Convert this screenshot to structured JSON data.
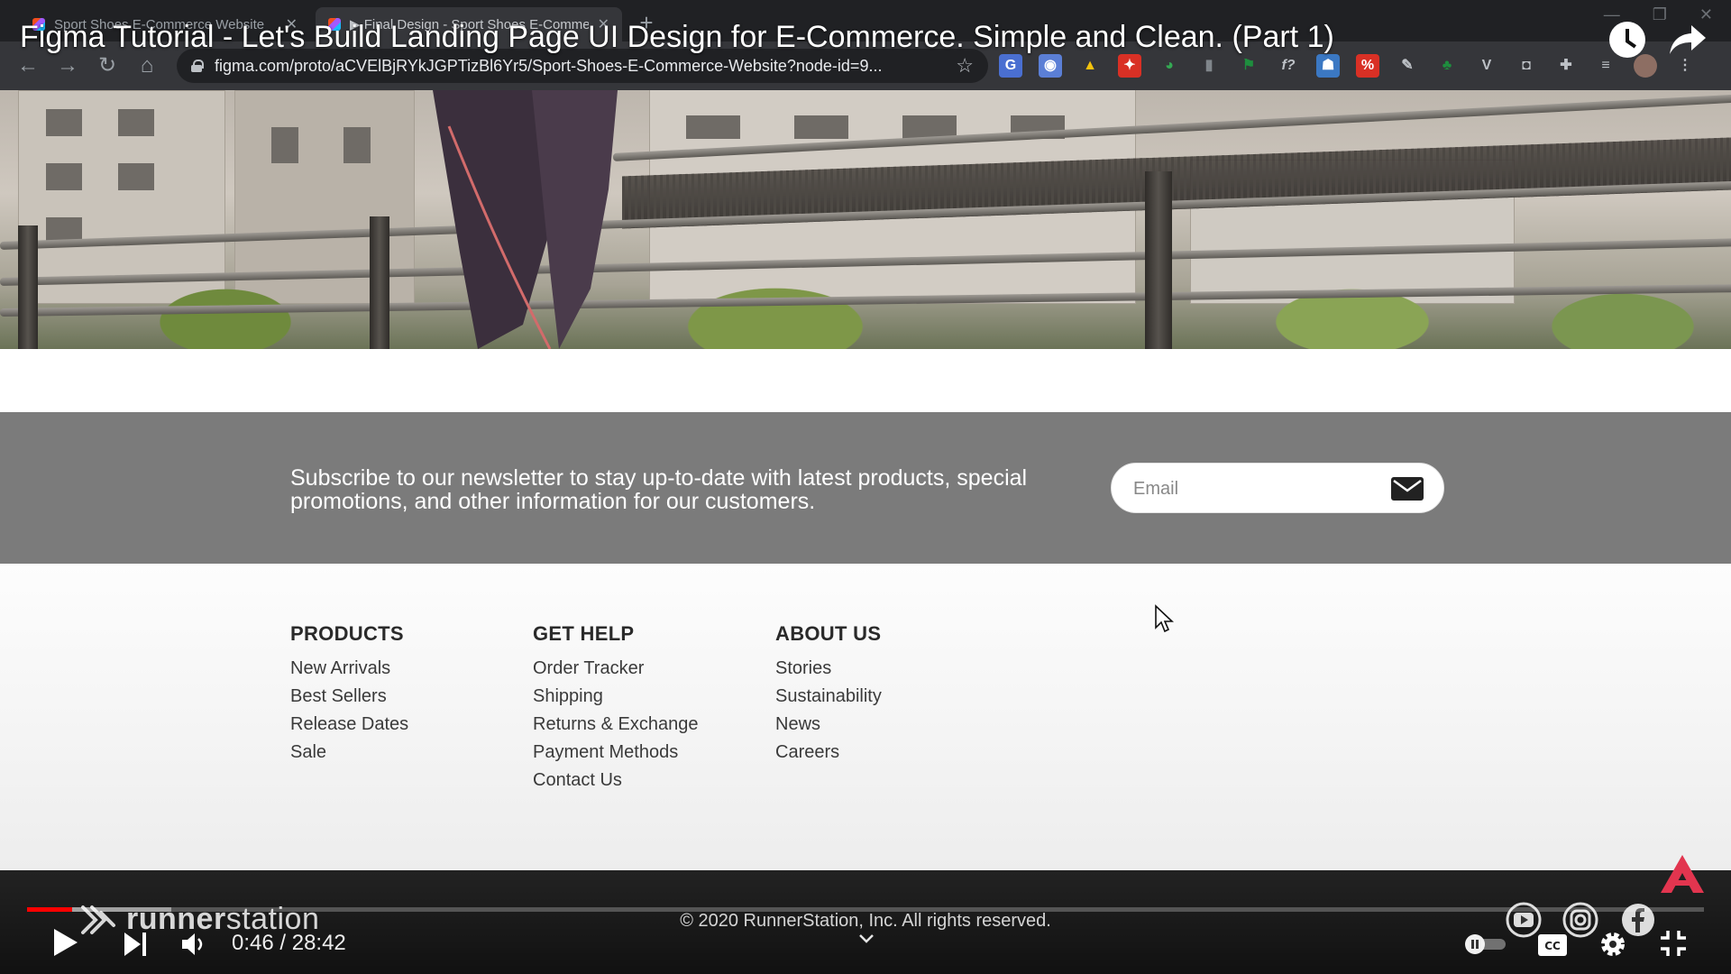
{
  "browser": {
    "tabs": [
      {
        "label": "Sport Shoes E-Commerce Website",
        "active": false
      },
      {
        "label": "▶ Final Design - Sport Shoes E-Commerce",
        "active": true
      }
    ],
    "url": "figma.com/proto/aCVElBjRYkJGPTizBl6Yr5/Sport-Shoes-E-Commerce-Website?node-id=9...",
    "extensions": [
      "translate-ext",
      "camera-ext",
      "drive-ext",
      "pin-ext",
      "chrome-ext",
      "bottle-ext",
      "flag-ext",
      "f-ext",
      "user-ext",
      "percent-ext",
      "pen-ext",
      "tree-ext",
      "v-ext",
      "camera2-ext",
      "puzzle-ext",
      "list-ext",
      "profile-ext",
      "menu-ext"
    ]
  },
  "video": {
    "title": "Figma Tutorial - Let's Build Landing Page UI Design for E-Commerce. Simple and Clean. (Part 1)",
    "time": "0:46 / 28:42",
    "progress": 0.027,
    "buffered": 0.086
  },
  "newsletter": {
    "text": "Subscribe to our newsletter to stay up-to-date with latest products, special promotions, and other information for our customers.",
    "email_placeholder": "Email"
  },
  "footer": {
    "columns": [
      {
        "heading": "PRODUCTS",
        "links": [
          "New Arrivals",
          "Best Sellers",
          "Release Dates",
          "Sale"
        ]
      },
      {
        "heading": "GET HELP",
        "links": [
          "Order Tracker",
          "Shipping",
          "Returns & Exchange",
          "Payment Methods",
          "Contact Us"
        ]
      },
      {
        "heading": "ABOUT US",
        "links": [
          "Stories",
          "Sustainability",
          "News",
          "Careers"
        ]
      }
    ],
    "brand_bold": "runner",
    "brand_light": "station",
    "copyright": "© 2020 RunnerStation, Inc. All rights reserved."
  },
  "colors": {
    "newsletter_bg": "#7b7b7b",
    "progress_red": "#ff0000",
    "ad_badge": "#e2354f"
  }
}
